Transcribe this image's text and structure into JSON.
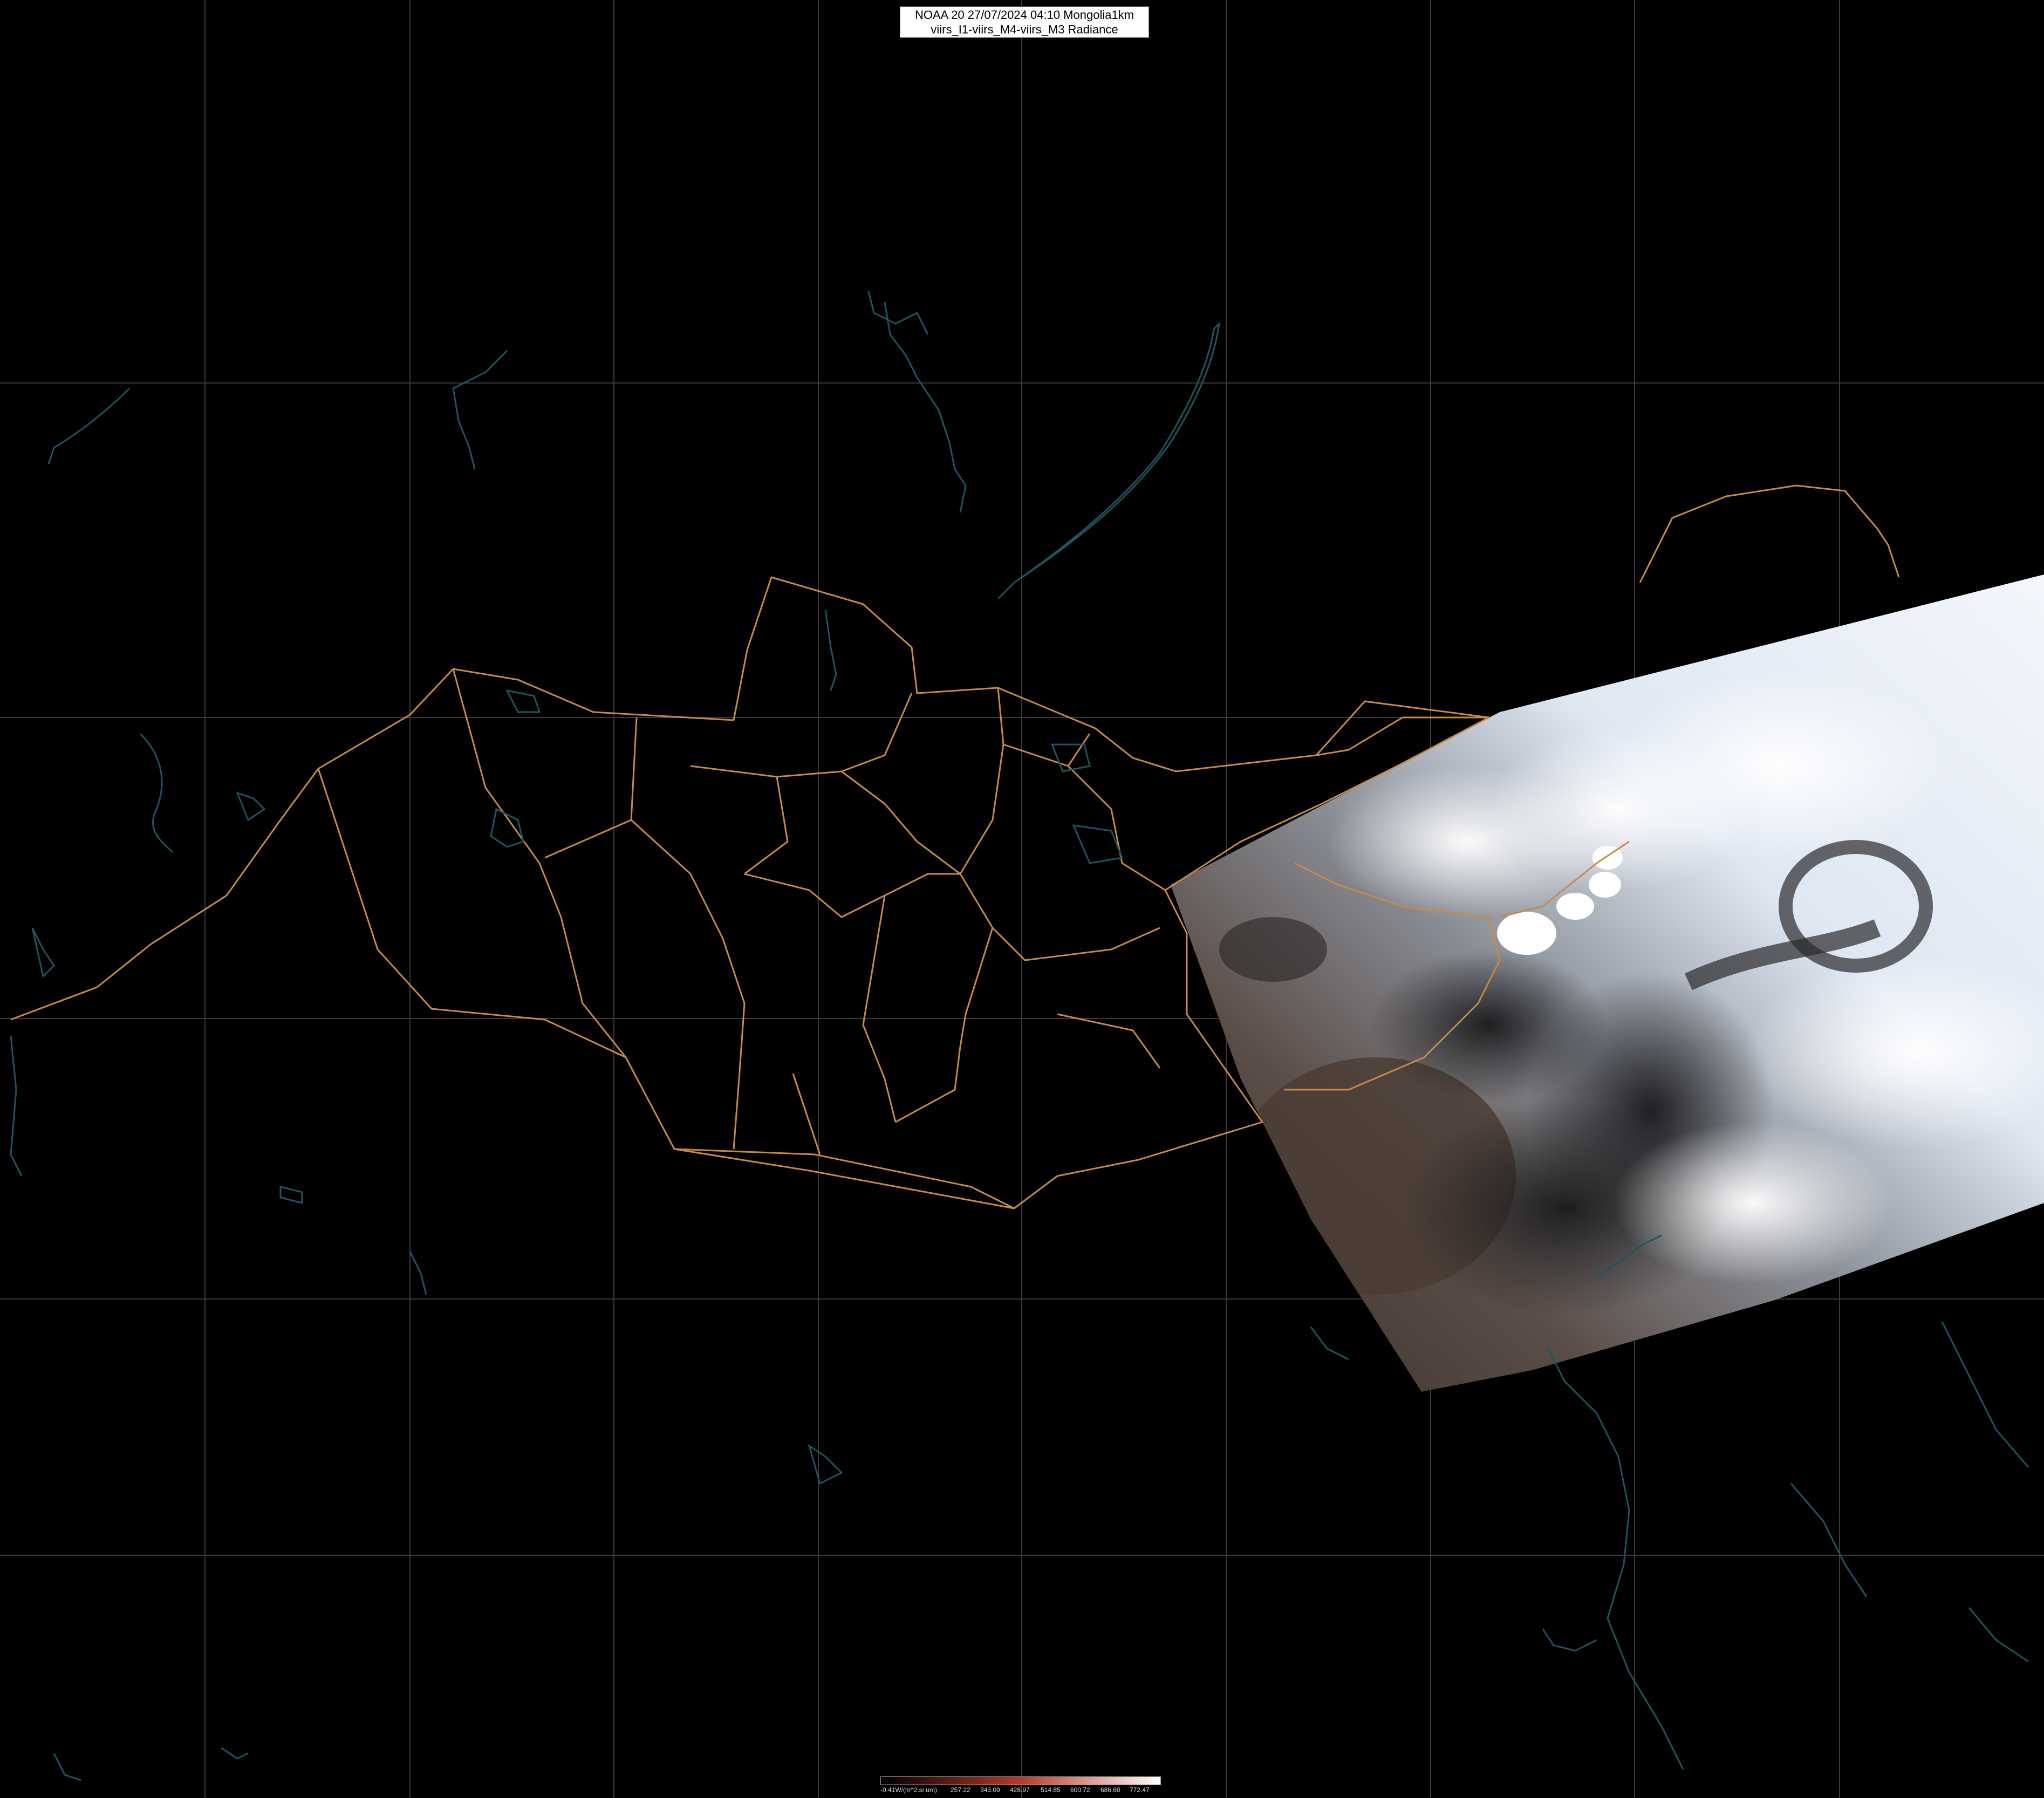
{
  "header": {
    "title_line1": "NOAA 20 27/07/2024 04:10 Mongolia1km",
    "title_line2": "viirs_I1-viirs_M4-viirs_M3 Radiance"
  },
  "legend": {
    "unit_label": "-0.41W/(m^2.sr.um)",
    "ticks": [
      "257.22",
      "343.09",
      "428.97",
      "514.85",
      "600.72",
      "686.60",
      "772.47"
    ],
    "color_start": "#000000",
    "color_mid": "#b83a2a",
    "color_end": "#ffffff"
  },
  "map": {
    "background_color": "#000000",
    "graticule_color": "#3a3a3a",
    "border_color": "#c98a45",
    "coastline_color": "#1d5560",
    "satellite_swath": "visible"
  }
}
